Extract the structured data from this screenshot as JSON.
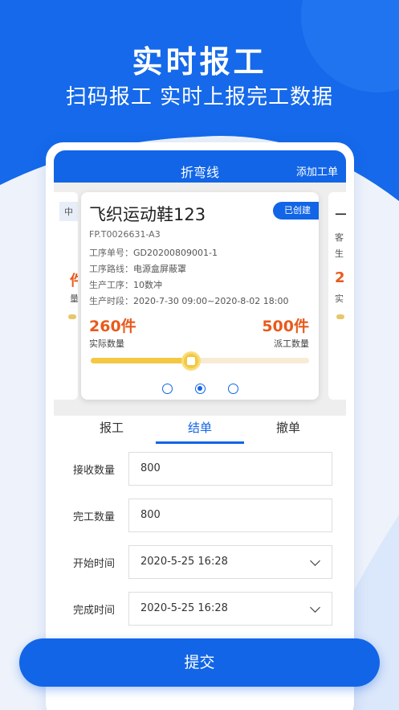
{
  "hero": {
    "title": "实时报工",
    "subtitle": "扫码报工  实时上报完工数据"
  },
  "colors": {
    "primary": "#1265e6",
    "accent_orange": "#e85a1c",
    "progress_yellow": "#f3c842"
  },
  "appbar": {
    "title": "折弯线",
    "action": "添加工单"
  },
  "side_left": {
    "tag": "中",
    "num": "件",
    "label": "量"
  },
  "side_right": {
    "title": "一",
    "line1": "客",
    "line2": "生",
    "num": "2",
    "label": "实"
  },
  "card": {
    "name": "飞织运动鞋123",
    "badge": "已创建",
    "code": "FP.T0026631-A3",
    "lines": [
      {
        "label": "工序单号：",
        "value": "GD20200809001-1"
      },
      {
        "label": "工序路线：",
        "value": "电源盒屏蔽罩"
      },
      {
        "label": "生产工序：",
        "value": "10数冲"
      },
      {
        "label": "生产时段：",
        "value": "2020-7-30 09:00~2020-8-02 18:00"
      }
    ],
    "actual_qty": "260件",
    "actual_label": "实际数量",
    "dispatch_qty": "500件",
    "dispatch_label": "派工数量",
    "progress": 0.46,
    "dots": 3,
    "active_dot": 1
  },
  "tabs": [
    {
      "label": "报工"
    },
    {
      "label": "结单"
    },
    {
      "label": "撤单"
    }
  ],
  "active_tab": 1,
  "form": {
    "received_label": "接收数量",
    "received_value": "800",
    "finished_label": "完工数量",
    "finished_value": "800",
    "start_label": "开始时间",
    "start_value": "2020-5-25 16:28",
    "end_label": "完成时间",
    "end_value": "2020-5-25 16:28"
  },
  "submit_label": "提交"
}
